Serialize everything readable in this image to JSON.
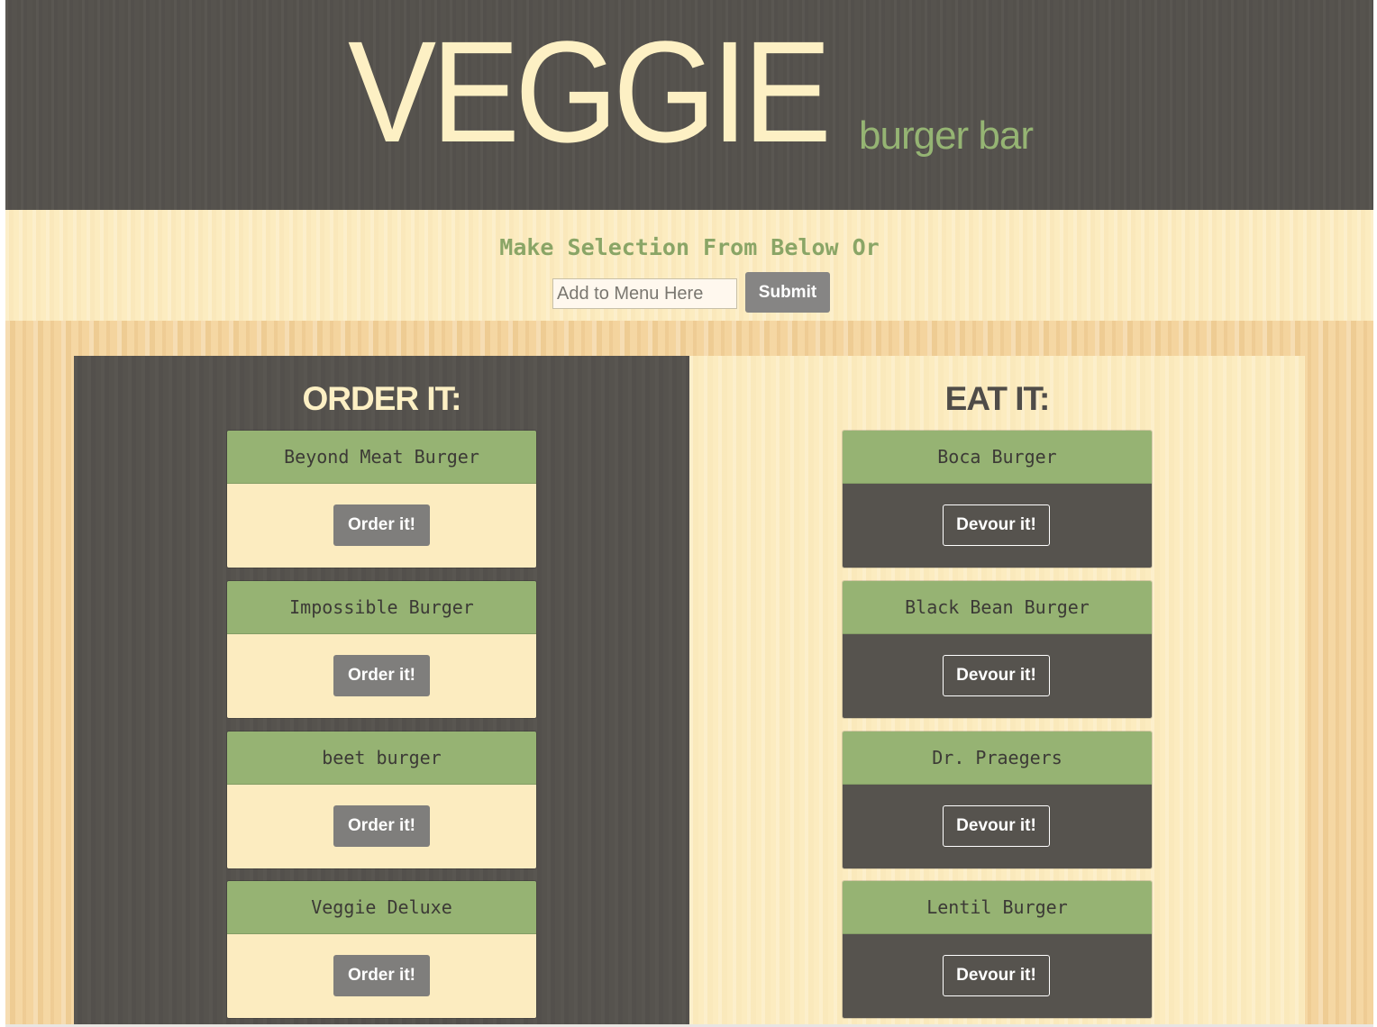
{
  "header": {
    "logo_main": "VEGGIE",
    "logo_sub": "burger bar"
  },
  "add_form": {
    "title": "Make Selection From Below Or",
    "input_placeholder": "Add to Menu Here",
    "submit_label": "Submit"
  },
  "order_panel": {
    "title": "ORDER IT:",
    "button_label": "Order it!",
    "items": [
      {
        "name": "Beyond Meat Burger"
      },
      {
        "name": "Impossible Burger"
      },
      {
        "name": "beet burger"
      },
      {
        "name": "Veggie Deluxe"
      }
    ]
  },
  "eat_panel": {
    "title": "EAT IT:",
    "button_label": "Devour it!",
    "items": [
      {
        "name": "Boca Burger"
      },
      {
        "name": "Black Bean Burger"
      },
      {
        "name": "Dr. Praegers"
      },
      {
        "name": "Lentil Burger"
      }
    ]
  },
  "colors": {
    "dark": "#56534e",
    "cream": "#fcecc0",
    "green": "#96b373",
    "logo_cream": "#fdf0c4",
    "button_gray": "#7f7e7c"
  }
}
